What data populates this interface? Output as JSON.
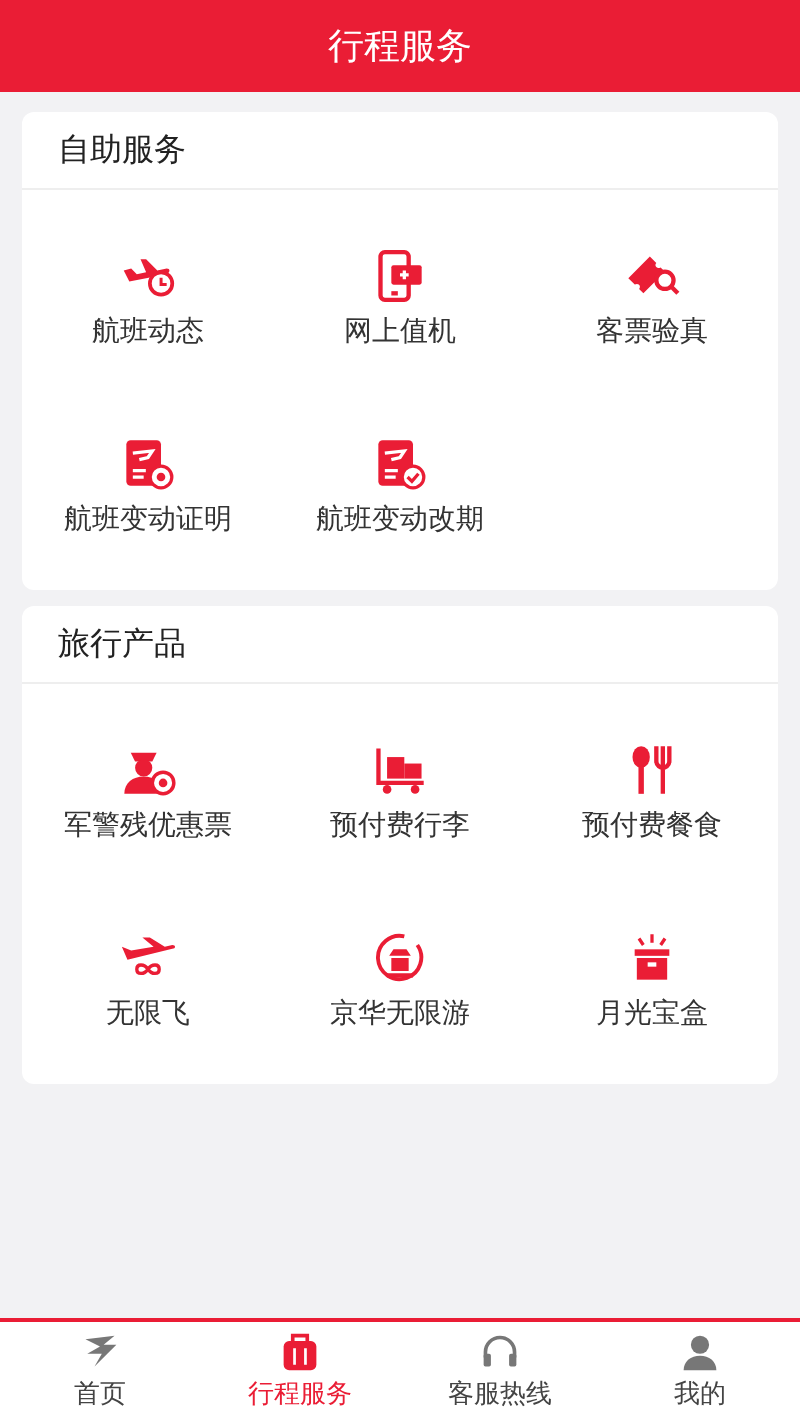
{
  "header": {
    "title": "行程服务"
  },
  "sections": [
    {
      "title": "自助服务",
      "items": [
        {
          "label": "航班动态"
        },
        {
          "label": "网上值机"
        },
        {
          "label": "客票验真"
        },
        {
          "label": "航班变动证明"
        },
        {
          "label": "航班变动改期"
        }
      ]
    },
    {
      "title": "旅行产品",
      "items": [
        {
          "label": "军警残优惠票"
        },
        {
          "label": "预付费行李"
        },
        {
          "label": "预付费餐食"
        },
        {
          "label": "无限飞"
        },
        {
          "label": "京华无限游"
        },
        {
          "label": "月光宝盒"
        }
      ]
    }
  ],
  "tabs": [
    {
      "label": "首页",
      "selected": false
    },
    {
      "label": "行程服务",
      "selected": true
    },
    {
      "label": "客服热线",
      "selected": false
    },
    {
      "label": "我的",
      "selected": false
    }
  ]
}
